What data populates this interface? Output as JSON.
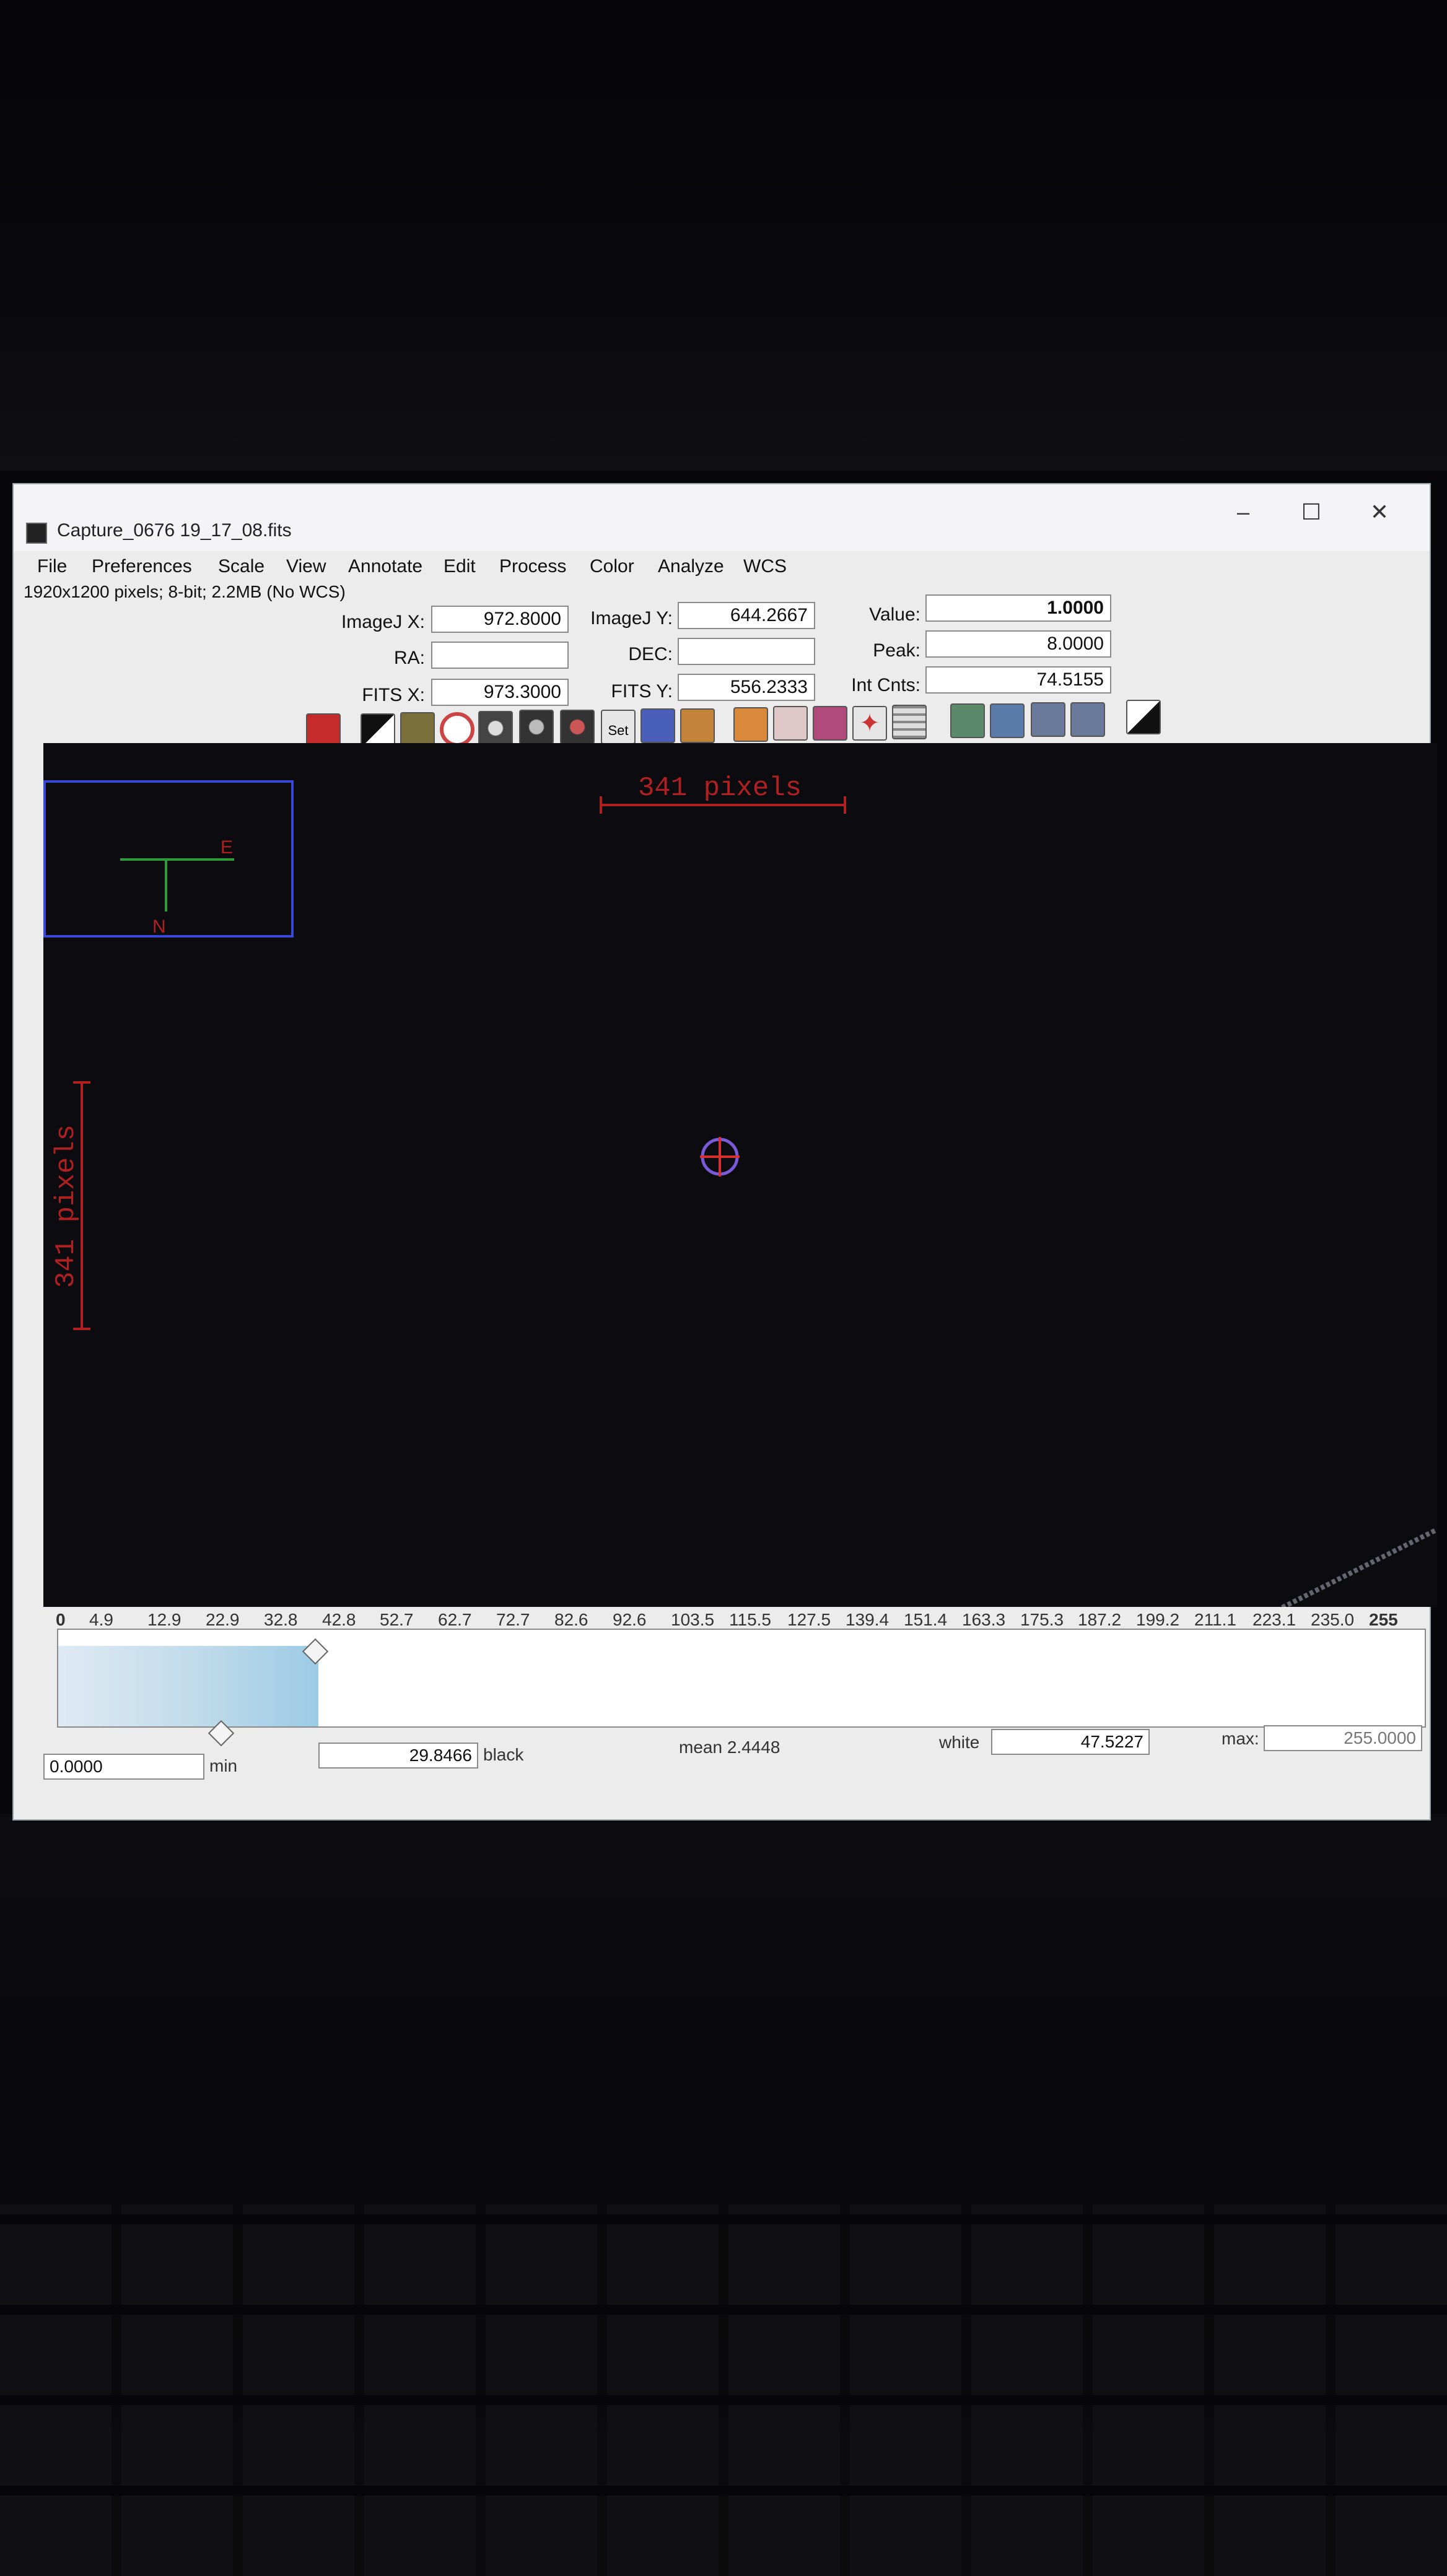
{
  "window": {
    "title": "Capture_0676 19_17_08.fits",
    "controls": {
      "minimize": "–",
      "maximize": "☐",
      "close": "✕"
    }
  },
  "menu": [
    "File",
    "Preferences",
    "Scale",
    "View",
    "Annotate",
    "Edit",
    "Process",
    "Color",
    "Analyze",
    "WCS"
  ],
  "status": "1920x1200 pixels; 8-bit; 2.2MB (No WCS)",
  "info": {
    "imagej_x_label": "ImageJ X:",
    "imagej_x": "972.8000",
    "imagej_y_label": "ImageJ Y:",
    "imagej_y": "644.2667",
    "value_label": "Value:",
    "value": "1.0000",
    "ra_label": "RA:",
    "ra": "",
    "dec_label": "DEC:",
    "dec": "",
    "peak_label": "Peak:",
    "peak": "8.0000",
    "fits_x_label": "FITS X:",
    "fits_x": "973.3000",
    "fits_y_label": "FITS Y:",
    "fits_y": "556.2333",
    "int_cnts_label": "Int Cnts:",
    "int_cnts": "74.5155"
  },
  "toolbar": {
    "set_label": "Set",
    "icons": [
      "stop-icon",
      "invert-icon",
      "image-icon",
      "aperture-ring-icon",
      "aperture-gray-icon",
      "aperture-mag-icon",
      "compass-icon",
      "set-icon",
      "pencil-icon",
      "clear-icon",
      "brush-icon",
      "multi-aperture-icon",
      "flower-icon",
      "star-icon",
      "table-icon",
      "zoom-fit-icon",
      "zoom-in-icon",
      "zoom-out-icon",
      "zoom-reset-icon",
      "contrast-icon"
    ]
  },
  "canvas": {
    "scale_label_h": "341 pixels",
    "scale_label_v": "341 pixels",
    "compass_e": "E",
    "compass_n": "N"
  },
  "histogram": {
    "ticks": [
      "0",
      "4.9",
      "12.9",
      "22.9",
      "32.8",
      "42.8",
      "52.7",
      "62.7",
      "72.7",
      "82.6",
      "92.6",
      "103.5",
      "115.5",
      "127.5",
      "139.4",
      "151.4",
      "163.3",
      "175.3",
      "187.2",
      "199.2",
      "211.1",
      "223.1",
      "235.0",
      "255"
    ],
    "min_value": "0.0000",
    "min_label": "min",
    "black_value": "29.8466",
    "black_label": "black",
    "mean_text": "mean 2.4448",
    "white_label": "white",
    "white_value": "47.5227",
    "max_label": "max:",
    "max_value": "255.0000"
  },
  "colors": {
    "canvas_bg": "#0b0b10",
    "scale_red": "#b02020",
    "compass_blue": "#3b47d6"
  }
}
